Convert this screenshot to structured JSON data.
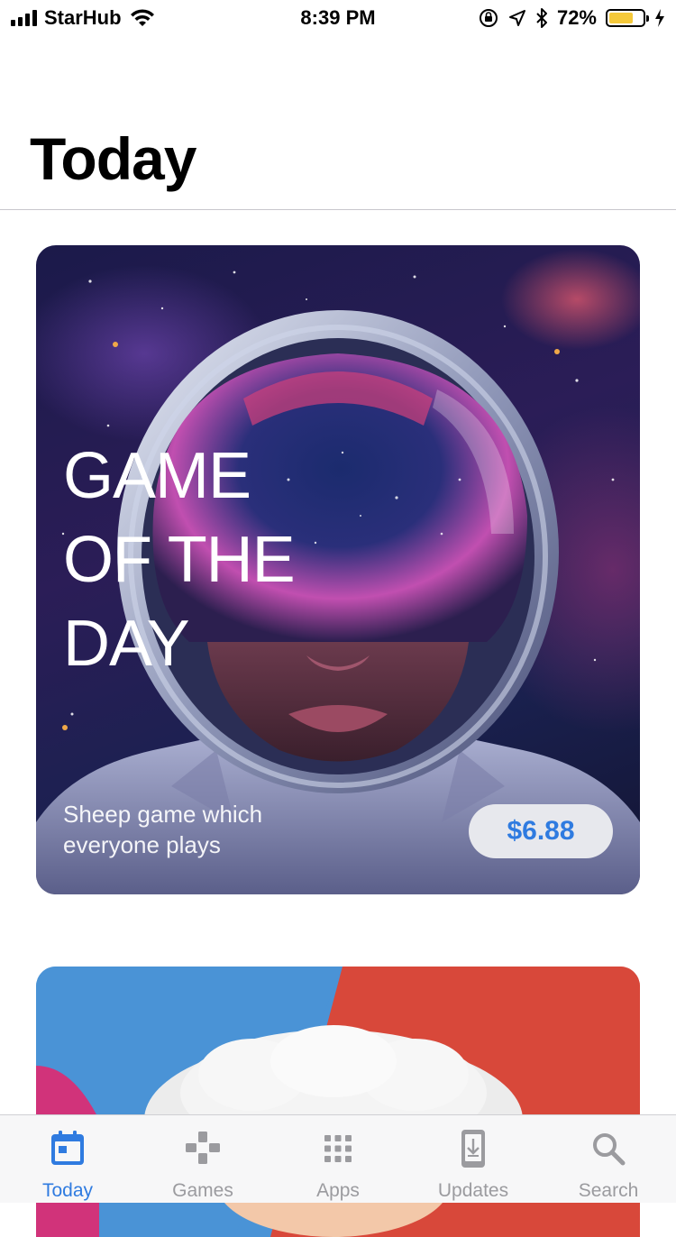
{
  "status_bar": {
    "carrier": "StarHub",
    "time": "8:39 PM",
    "battery_percent": "72%",
    "battery_level": 0.72,
    "battery_color": "#f5c93a",
    "icons": [
      "signal-icon",
      "wifi-icon",
      "orientation-lock-icon",
      "location-icon",
      "bluetooth-icon",
      "battery-icon",
      "charging-icon"
    ]
  },
  "header": {
    "title": "Today"
  },
  "feature_card": {
    "heading": "GAME\nOF THE\nDAY",
    "subtitle": "Sheep game which everyone plays",
    "price": "$6.88",
    "accent_color": "#2f7be0"
  },
  "tab_bar": {
    "active_color": "#2f7be0",
    "inactive_color": "#9b9b9f",
    "tabs": [
      {
        "label": "Today",
        "icon": "today-icon",
        "active": true
      },
      {
        "label": "Games",
        "icon": "games-icon",
        "active": false
      },
      {
        "label": "Apps",
        "icon": "apps-icon",
        "active": false
      },
      {
        "label": "Updates",
        "icon": "updates-icon",
        "active": false
      },
      {
        "label": "Search",
        "icon": "search-icon",
        "active": false
      }
    ]
  }
}
